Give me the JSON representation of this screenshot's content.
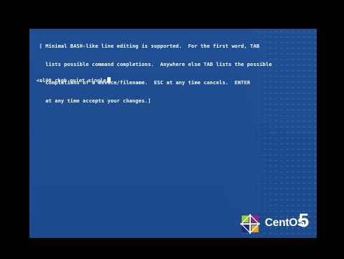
{
  "help_lines": [
    "[ Minimal BASH-like line editing is supported.  For the first word, TAB",
    "  lists possible command completions.  Anywhere else TAB lists the possible",
    "  completions of a device/filename.  ESC at any time cancels.  ENTER",
    "  at any time accepts your changes.]"
  ],
  "command_line": "<ol00 rhgb quiet single",
  "logo": {
    "text": "CentOS",
    "version": "5",
    "colors": [
      "#9ccd2a",
      "#e9a31b",
      "#932279",
      "#262577"
    ]
  },
  "colors": {
    "screen_bg": "#1f4f93",
    "frame_bg": "#000000",
    "text": "#ffffff"
  }
}
